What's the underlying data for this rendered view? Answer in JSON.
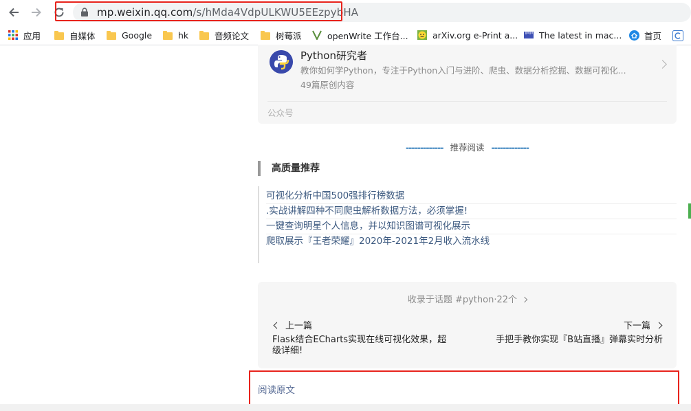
{
  "browser": {
    "url_host": "mp.weixin.qq.com",
    "url_path": "/s/hMda4VdpULKWU5EEzpybHA",
    "bookmarks": [
      {
        "label": "应用",
        "icon": "apps-grid-icon"
      },
      {
        "label": "自媒体",
        "icon": "folder-icon"
      },
      {
        "label": "Google",
        "icon": "folder-icon"
      },
      {
        "label": "hk",
        "icon": "folder-icon"
      },
      {
        "label": "音频论文",
        "icon": "folder-icon"
      },
      {
        "label": "树莓派",
        "icon": "folder-icon"
      },
      {
        "label": "openWrite 工作台...",
        "icon": "openwrite-icon"
      },
      {
        "label": "arXiv.org e-Print a...",
        "icon": "arxiv-smiley-icon"
      },
      {
        "label": "The latest in mac...",
        "icon": "ruler-icon"
      },
      {
        "label": "首页",
        "icon": "home-badge-icon"
      }
    ]
  },
  "account": {
    "name": "Python研究者",
    "description": "教你如何学Python，专注于Python入门与进阶、爬虫、数据分析挖掘、数据可视化...",
    "original_count": "49篇原创内容",
    "type_label": "公众号"
  },
  "recommend": {
    "dash": "-------------",
    "title": "推荐阅读",
    "section_title": "高质量推荐",
    "items": [
      "可视化分析中国500强排行榜数据",
      ".实战讲解四种不同爬虫解析数据方法，必须掌握!",
      "一键查询明星个人信息，并以知识图谱可视化展示",
      "爬取展示『王者荣耀』2020年-2021年2月收入流水线"
    ]
  },
  "topic": {
    "collected": "收录于话题 #python·22个",
    "prev_label": "上一篇",
    "prev_title_line1": "Flask结合ECharts实现在线可视化效果，超",
    "prev_title_line2": "级详细!",
    "next_label": "下一篇",
    "next_title": "手把手教你实现『B站直播』弹幕实时分析"
  },
  "read_original": "阅读原文",
  "colors": {
    "highlight": "#e8231c",
    "link": "#576b95",
    "list_link": "#3d5a80",
    "dash": "#1a6fb3"
  }
}
